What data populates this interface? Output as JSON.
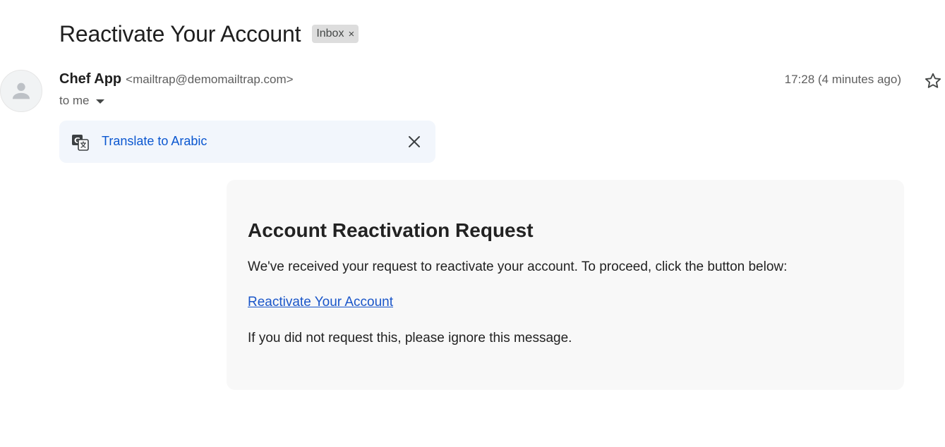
{
  "subject": "Reactivate Your Account",
  "label_chip": {
    "text": "Inbox",
    "close_glyph": "×"
  },
  "sender": {
    "name": "Chef App",
    "email": "<mailtrap@demomailtrap.com>"
  },
  "recipient": {
    "text": "to me"
  },
  "timestamp": "17:28 (4 minutes ago)",
  "translate_bar": {
    "link": "Translate to Arabic"
  },
  "email_body": {
    "heading": "Account Reactivation Request",
    "paragraph": "We've received your request to reactivate your account. To proceed, click the button below:",
    "link": "Reactivate Your Account",
    "footer": "If you did not request this, please ignore this message."
  },
  "colors": {
    "link_blue": "#0b57d0",
    "card_bg": "#f8f8f8",
    "translate_bg": "#f2f6fc",
    "chip_bg": "#dddddd"
  },
  "icons": [
    "avatar-placeholder-icon",
    "chevron-down-icon",
    "star-icon",
    "translate-icon",
    "close-icon",
    "label-remove-icon"
  ]
}
